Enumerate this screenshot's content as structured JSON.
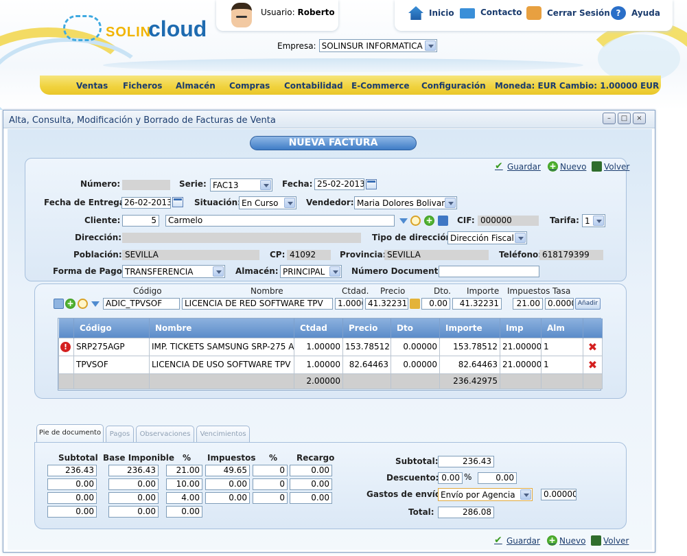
{
  "header": {
    "logo_prefix": "SOLIN",
    "logo_suffix": "cloud",
    "user_label": "Usuario:",
    "user_name": "Roberto",
    "nav": [
      "Inicio",
      "Contacto",
      "Cerrar Sesión",
      "Ayuda"
    ],
    "empresa_label": "Empresa:",
    "empresa_value": "SOLINSUR INFORMATICA"
  },
  "menu": [
    "Ventas",
    "Ficheros",
    "Almacén",
    "Compras",
    "Contabilidad",
    "E-Commerce",
    "Configuración",
    "Moneda: EUR Cambio: 1.00000 EUR"
  ],
  "window": {
    "title": "Alta, Consulta, Modificación y Borrado de Facturas de Venta",
    "heading": "NUEVA FACTURA"
  },
  "actions": {
    "guardar": "Guardar",
    "nuevo": "Nuevo",
    "volver": "Volver"
  },
  "form": {
    "numero_label": "Número:",
    "numero_value": "",
    "serie_label": "Serie:",
    "serie_value": "FAC13",
    "fecha_label": "Fecha:",
    "fecha_value": "25-02-2013",
    "fecha_entrega_label": "Fecha de Entrega:",
    "fecha_entrega_value": "26-02-2013",
    "situacion_label": "Situación:",
    "situacion_value": "En Curso",
    "vendedor_label": "Vendedor:",
    "vendedor_value": "Maria Dolores Bolivar",
    "cliente_label": "Cliente:",
    "cliente_code": "5",
    "cliente_name": "Carmelo",
    "cif_label": "CIF:",
    "cif_value": "000000",
    "tarifa_label": "Tarifa:",
    "tarifa_value": "1",
    "direccion_label": "Dirección:",
    "direccion_value": "",
    "tipo_direccion_label": "Tipo de dirección:",
    "tipo_direccion_value": "Dirección Fiscal",
    "poblacion_label": "Población:",
    "poblacion_value": "SEVILLA",
    "cp_label": "CP:",
    "cp_value": "41092",
    "provincia_label": "Provincia:",
    "provincia_value": "SEVILLA",
    "telefono_label": "Teléfono:",
    "telefono_value": "618179399",
    "forma_pago_label": "Forma de Pago:",
    "forma_pago_value": "TRANSFERENCIA",
    "almacen_label": "Almacén:",
    "almacen_value": "PRINCIPAL",
    "numero_documento_label": "Número Documento:",
    "numero_documento_value": ""
  },
  "line_entry": {
    "headers": [
      "Código",
      "Nombre",
      "Ctdad.",
      "Precio",
      "Dto.",
      "Importe",
      "Impuestos",
      "Tasa"
    ],
    "codigo": "ADIC_TPVSOF",
    "nombre": "LICENCIA DE RED SOFTWARE TPV",
    "ctdad": "1.0000",
    "precio": "41.32231",
    "dto": "0.00",
    "importe": "41.32231",
    "impuestos": "21.00",
    "tasa": "0.0000",
    "add_label": "Añadir"
  },
  "lines_table": {
    "columns": [
      "Código",
      "Nombre",
      "Ctdad",
      "Precio",
      "Dto",
      "Importe",
      "Imp",
      "Alm"
    ],
    "rows": [
      {
        "warning": true,
        "codigo": "SRP275AGP",
        "nombre": "IMP. TICKETS SAMSUNG SRP-275 A",
        "ctdad": "1.00000",
        "precio": "153.78512",
        "dto": "0.00000",
        "importe": "153.78512",
        "imp": "21.00000",
        "alm": "1"
      },
      {
        "warning": false,
        "codigo": "TPVSOF",
        "nombre": "LICENCIA DE USO SOFTWARE TPV",
        "ctdad": "1.00000",
        "precio": "82.64463",
        "dto": "0.00000",
        "importe": "82.64463",
        "imp": "21.00000",
        "alm": "1"
      }
    ],
    "total_ctdad": "2.00000",
    "total_importe": "236.42975"
  },
  "tabs": [
    "Pie de documento",
    "Pagos",
    "Observaciones",
    "Vencimientos"
  ],
  "footer": {
    "headers": [
      "Subtotal",
      "Base Imponible",
      "%",
      "Impuestos",
      "%",
      "Recargo"
    ],
    "rows": [
      [
        "236.43",
        "236.43",
        "21.00",
        "49.65",
        "0",
        "0.00"
      ],
      [
        "0.00",
        "0.00",
        "10.00",
        "0.00",
        "0",
        "0.00"
      ],
      [
        "0.00",
        "0.00",
        "4.00",
        "0.00",
        "0",
        "0.00"
      ],
      [
        "0.00",
        "0.00",
        "0.00"
      ]
    ],
    "subtotal_label": "Subtotal:",
    "subtotal_value": "236.43",
    "descuento_label": "Descuento:",
    "descuento_pct": "0.00",
    "descuento_pct_sign": "%",
    "descuento_value": "0.00",
    "gastos_label": "Gastos de envío:",
    "gastos_option": "Envío por Agencia",
    "gastos_value": "0.00000",
    "total_label": "Total:",
    "total_value": "286.08"
  }
}
